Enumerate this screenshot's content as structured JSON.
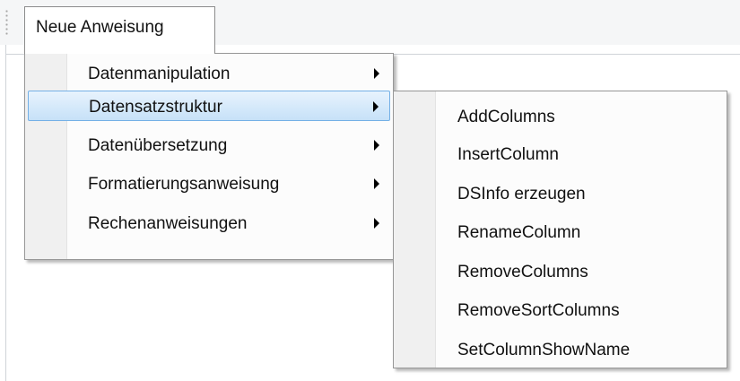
{
  "menubar": {
    "top_label": "Neue Anweisung"
  },
  "menu": {
    "items": [
      {
        "label": "Datenmanipulation",
        "submenu": true
      },
      {
        "label": "Datensatzstruktur",
        "submenu": true,
        "highlighted": true
      },
      {
        "label": "Datenübersetzung",
        "submenu": true
      },
      {
        "label": "Formatierungsanweisung",
        "submenu": true
      },
      {
        "label": "Rechenanweisungen",
        "submenu": true
      }
    ]
  },
  "submenu": {
    "items": [
      {
        "label": "AddColumns"
      },
      {
        "label": "InsertColumn"
      },
      {
        "label": "DSInfo erzeugen"
      },
      {
        "label": "RenameColumn"
      },
      {
        "label": "RemoveColumns"
      },
      {
        "label": "RemoveSortColumns"
      },
      {
        "label": "SetColumnShowName"
      }
    ]
  },
  "colors": {
    "highlight_border": "#74b0e6",
    "highlight_fill": "#c6e1f8",
    "menu_bg": "#f0f0f0"
  }
}
